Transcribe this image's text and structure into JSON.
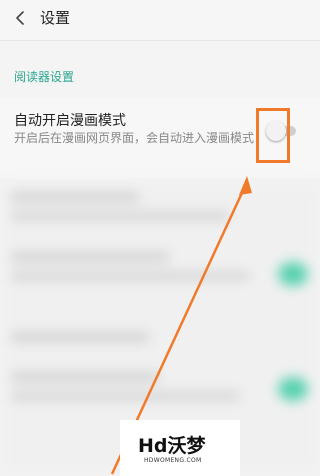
{
  "header": {
    "title": "设置",
    "back_icon": "back-arrow-icon"
  },
  "section": {
    "header": "阅读器设置"
  },
  "setting": {
    "title": "自动开启漫画模式",
    "description": "开启后在漫画网页界面，会自动进入漫画模式",
    "toggle_state": "off"
  },
  "colors": {
    "accent": "#2aa58f",
    "annotation": "#f07a2a",
    "blurred_toggle": "#58d1b0"
  },
  "watermark": {
    "text": "Hd沃梦",
    "subtext": "HDWOMENG.COM"
  }
}
